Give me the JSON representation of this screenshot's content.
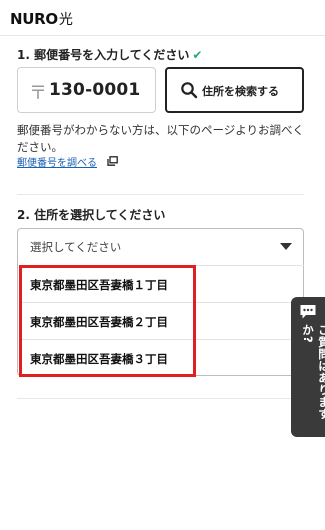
{
  "header": {
    "logo_main": "NURO",
    "logo_sub": "光"
  },
  "step1": {
    "title": "1. 郵便番号を入力してください",
    "zip_mark": "〒",
    "zip_value": "130-0001",
    "search_button_label": "住所を検索する",
    "help_text": "郵便番号がわからない方は、以下のページよりお調べください。",
    "help_link": "郵便番号を調べる"
  },
  "step2": {
    "title": "2. 住所を選択してください",
    "select_placeholder": "選択してください",
    "options": [
      "東京都墨田区吾妻橋１丁目",
      "東京都墨田区吾妻橋２丁目",
      "東京都墨田区吾妻橋３丁目"
    ]
  },
  "question_tab": {
    "label": "ご質問はありますか?"
  },
  "colors": {
    "accent_check": "#2aa876",
    "highlight": "#e02020",
    "link": "#1a5fb4",
    "tab_bg": "#3a3a3a"
  }
}
